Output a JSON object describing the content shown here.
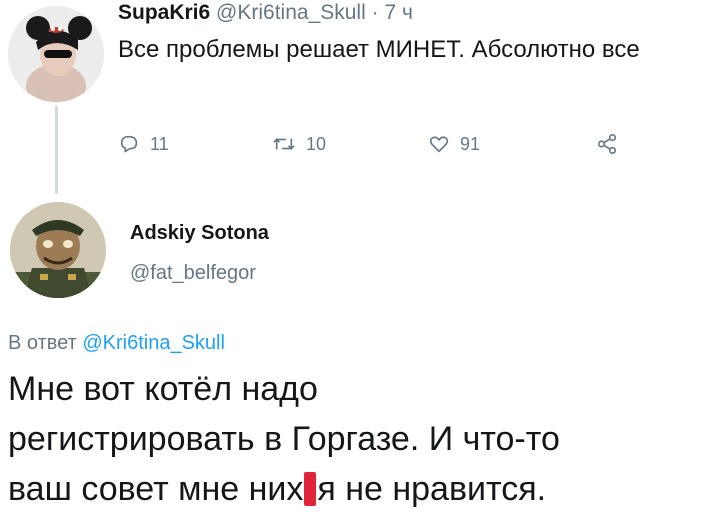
{
  "tweet": {
    "author_name": "SupaKri6",
    "author_handle": "@Kri6tina_Skull",
    "separator": "·",
    "time": "7 ч",
    "text": "Все проблемы решает МИНЕТ. Абсолютно все",
    "actions": {
      "replies": "11",
      "retweets": "10",
      "likes": "91"
    }
  },
  "reply": {
    "author_name": "Adskiy Sotona",
    "author_handle": "@fat_belfegor",
    "replying_to_prefix": "В ответ",
    "replying_to_handle": "@Kri6tina_Skull",
    "text_line1": "Мне вот котёл надо",
    "text_line2": "регистрировать в Горгазе. И что-то",
    "text_line3_before": "ваш совет мне них",
    "text_line3_after": "я не нравится."
  },
  "icons": {
    "reply": "reply-icon",
    "retweet": "retweet-icon",
    "like": "heart-icon",
    "share": "share-icon"
  },
  "colors": {
    "text": "#14171a",
    "muted": "#657786",
    "link": "#1da1f2",
    "censor": "#e0243a"
  }
}
